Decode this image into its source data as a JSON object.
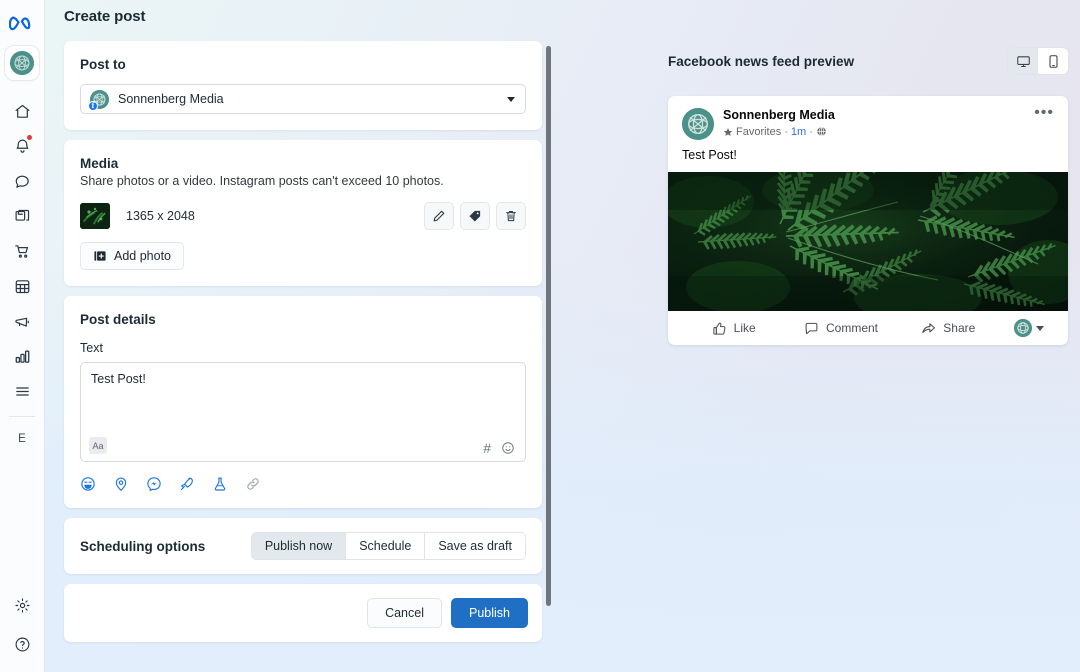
{
  "page": {
    "title": "Create post"
  },
  "sidebar": {
    "logo": "meta-logo",
    "brand_avatar": "sonnenberg-media-avatar",
    "items": [
      {
        "icon": "home-icon",
        "name": "home"
      },
      {
        "icon": "bell-icon",
        "name": "notifications",
        "badge": true
      },
      {
        "icon": "chat-bubble-icon",
        "name": "inbox"
      },
      {
        "icon": "posts-icon",
        "name": "content"
      },
      {
        "icon": "cart-icon",
        "name": "commerce"
      },
      {
        "icon": "grid-icon",
        "name": "planner"
      },
      {
        "icon": "megaphone-icon",
        "name": "ads"
      },
      {
        "icon": "bar-chart-icon",
        "name": "insights"
      },
      {
        "icon": "menu-icon",
        "name": "more"
      }
    ],
    "initial": "E",
    "bottom": [
      {
        "icon": "gear-icon",
        "name": "settings"
      },
      {
        "icon": "question-icon",
        "name": "help"
      }
    ]
  },
  "post_to": {
    "heading": "Post to",
    "selected": "Sonnenberg Media",
    "badge": "f"
  },
  "media": {
    "heading": "Media",
    "description": "Share photos or a video. Instagram posts can't exceed 10 photos.",
    "item_dimensions": "1365 x 2048",
    "actions": [
      {
        "icon": "pencil-icon",
        "name": "edit-media"
      },
      {
        "icon": "tag-icon",
        "name": "tag-media"
      },
      {
        "icon": "trash-icon",
        "name": "delete-media"
      }
    ],
    "add_photo_label": "Add photo"
  },
  "post_details": {
    "heading": "Post details",
    "text_label": "Text",
    "text_value": "Test Post!",
    "text_placeholder": "",
    "format_button": "Aa",
    "hashtag_icon": "#",
    "emoji_icon": "emoji-icon",
    "actions": [
      {
        "icon": "feeling-icon",
        "name": "feeling-activity"
      },
      {
        "icon": "location-icon",
        "name": "check-in"
      },
      {
        "icon": "messenger-icon",
        "name": "messenger"
      },
      {
        "icon": "rocket-icon",
        "name": "boost"
      },
      {
        "icon": "flask-icon",
        "name": "experiment"
      },
      {
        "icon": "link-icon",
        "name": "link"
      }
    ]
  },
  "scheduling": {
    "heading": "Scheduling options",
    "options": [
      "Publish now",
      "Schedule",
      "Save as draft"
    ],
    "selected_index": 0
  },
  "footer": {
    "cancel_label": "Cancel",
    "publish_label": "Publish"
  },
  "preview": {
    "title": "Facebook news feed preview",
    "devices": [
      {
        "icon": "desktop-icon",
        "name": "desktop",
        "selected": true
      },
      {
        "icon": "mobile-icon",
        "name": "mobile",
        "selected": false
      }
    ],
    "post": {
      "author": "Sonnenberg Media",
      "audience": "Favorites",
      "time": "1m",
      "privacy_icon": "globe-icon",
      "menu_icon": "more-options-icon",
      "body": "Test Post!",
      "image": "fern-photo",
      "actions": [
        {
          "label": "Like",
          "icon": "thumbs-up-icon"
        },
        {
          "label": "Comment",
          "icon": "comment-icon"
        },
        {
          "label": "Share",
          "icon": "share-icon"
        }
      ]
    }
  },
  "colors": {
    "primary": "#1f6fc4",
    "brand_teal": "#4c9189",
    "facebook_blue": "#1877f2",
    "link_blue": "#2d6ed4",
    "notification_red": "#e53935",
    "action_icon_blue": "#1b74e4"
  }
}
